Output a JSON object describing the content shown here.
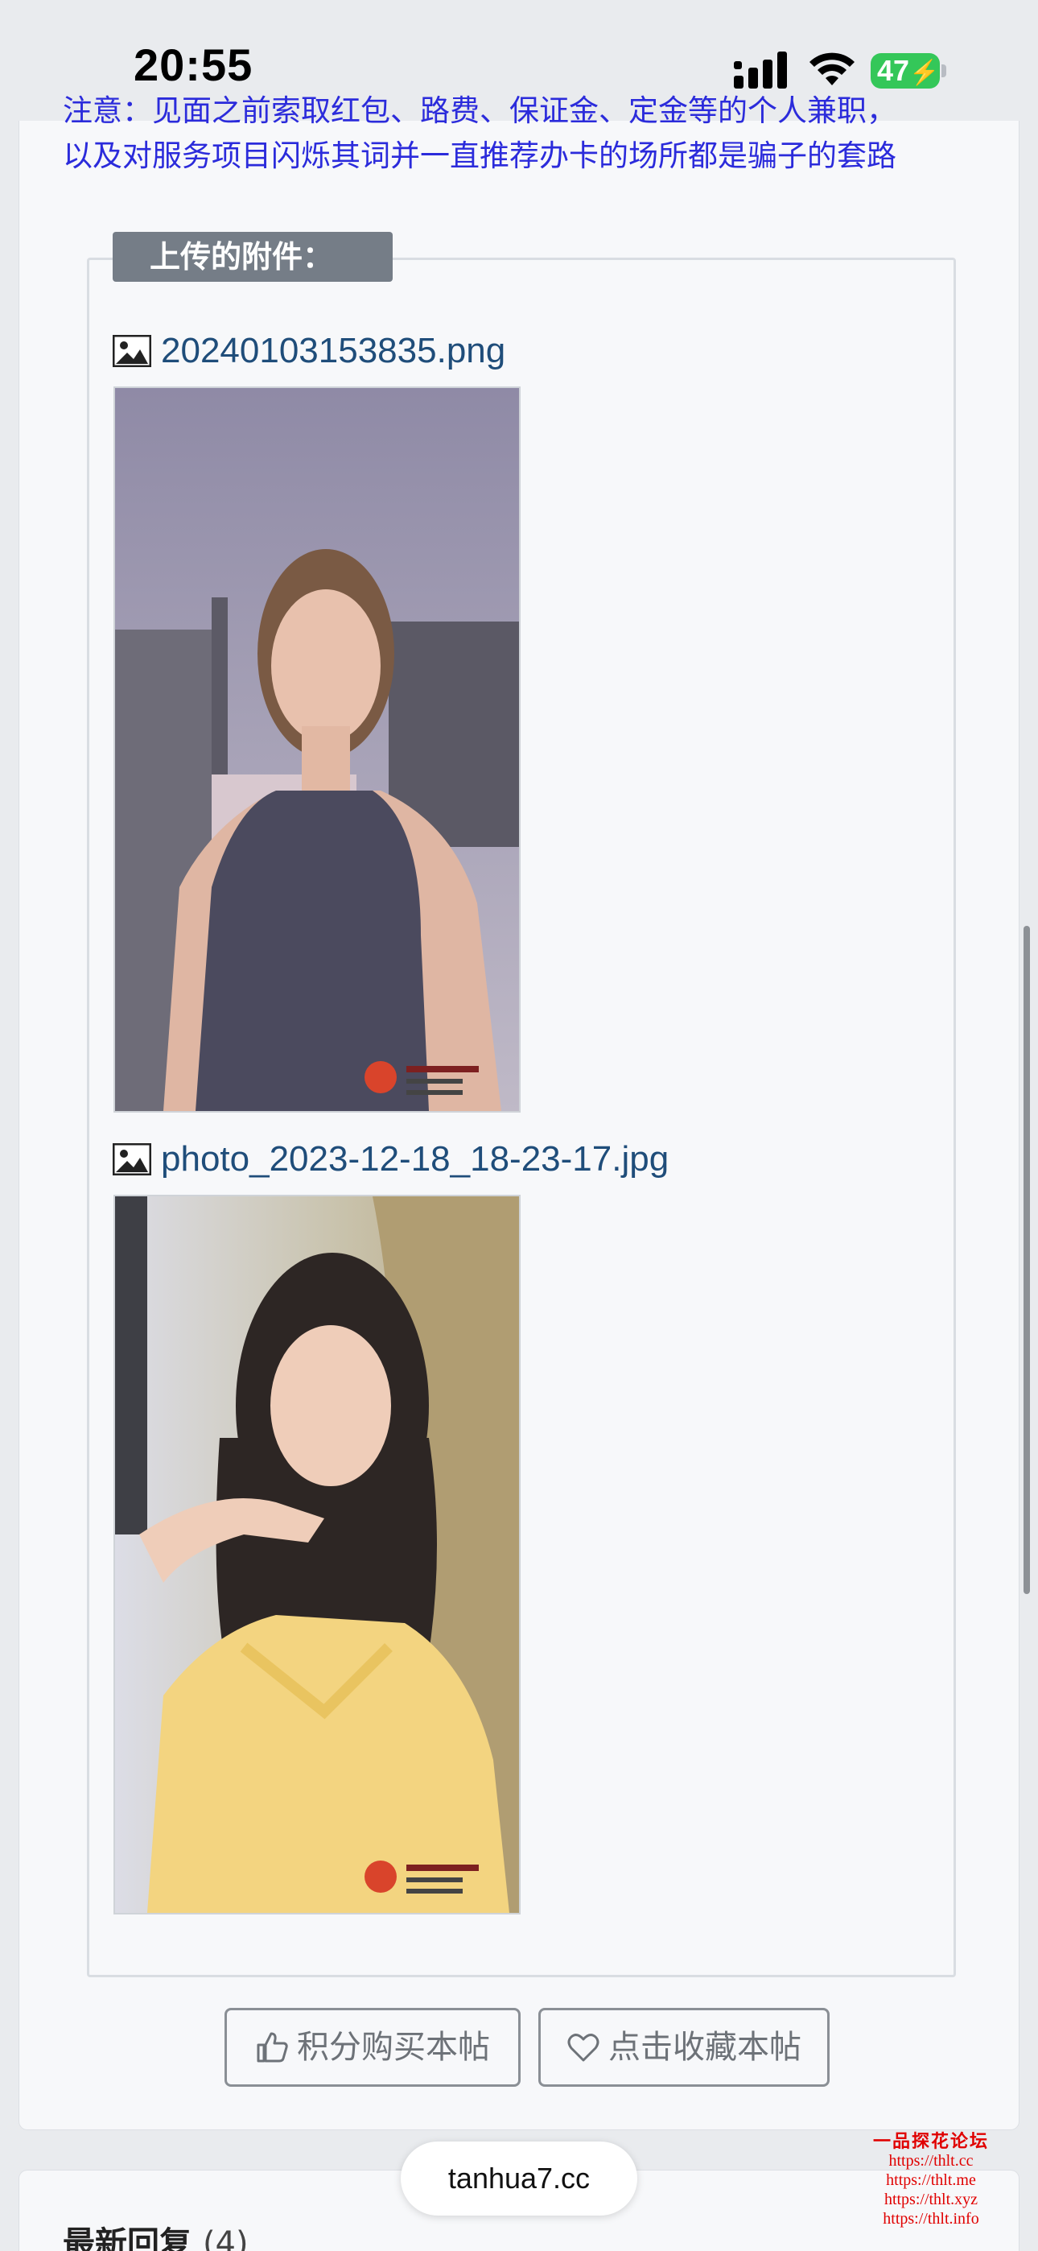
{
  "status_bar": {
    "time": "20:55",
    "battery": "47",
    "icons": [
      "signal-icon",
      "wifi-icon",
      "battery-charging-icon"
    ]
  },
  "notice": {
    "line1": "注意：见面之前索取红包、路费、保证金、定金等的个人兼职，",
    "line2": "以及对服务项目闪烁其词并一直推荐办卡的场所都是骗子的套路",
    "color": "#2b2bdb"
  },
  "attachments": {
    "legend": "上传的附件：",
    "items": [
      {
        "filename": "20240103153835.png",
        "icon": "image-icon"
      },
      {
        "filename": "photo_2023-12-18_18-23-17.jpg",
        "icon": "image-icon"
      }
    ]
  },
  "actions": {
    "buy_label": "积分购买本帖",
    "favorite_label": "点击收藏本帖"
  },
  "replies": {
    "title": "最新回复",
    "count": "(4)"
  },
  "browser": {
    "domain": "tanhua7.cc"
  },
  "watermark": {
    "brand": "一品探花论坛",
    "urls": [
      "https://thlt.cc",
      "https://thlt.me",
      "https://thlt.xyz",
      "https://thlt.info"
    ]
  }
}
